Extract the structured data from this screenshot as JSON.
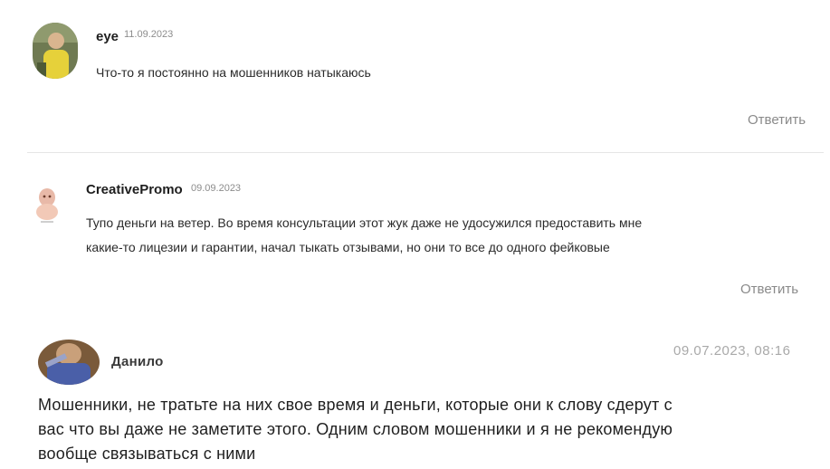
{
  "comments": [
    {
      "author": "eye",
      "date": "11.09.2023",
      "text": "Что-то я постоянно на мошенников натыкаюсь",
      "reply_label": "Ответить"
    },
    {
      "author": "CreativePromo",
      "date": "09.09.2023",
      "text_lines": [
        "Тупо деньги на ветер. Во время консультации этот жук даже не удосужился предоставить мне",
        "какие-то лицезии и гарантии, начал тыкать отзывами, но они то все до одного фейковые"
      ],
      "reply_label": "Ответить"
    },
    {
      "author": "Данило",
      "date": "09.07.2023, 08:16",
      "text_lines": [
        "Мошенники, не тратьте на них свое время и деньги, которые они к слову сдерут с",
        "вас что вы даже не заметите этого. Одним словом мошенники и я не рекомендую",
        "вообще связываться с ними"
      ]
    }
  ]
}
